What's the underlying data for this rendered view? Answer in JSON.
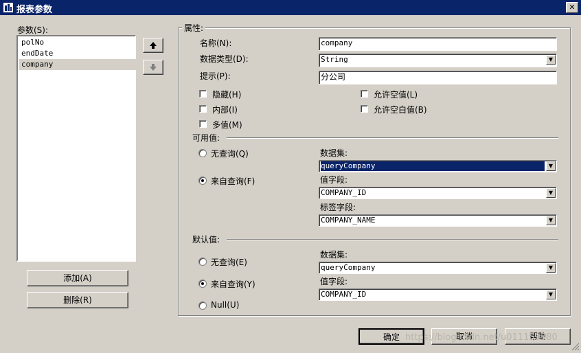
{
  "window": {
    "title": "报表参数",
    "close_glyph": "✕"
  },
  "params": {
    "label": "参数(S):",
    "items": [
      "polNo",
      "endDate",
      "company"
    ],
    "selected_index": 2,
    "add_label": "添加(A)",
    "delete_label": "删除(R)",
    "up_glyph": "🡅",
    "down_glyph": "🡇"
  },
  "properties": {
    "group_label": "属性:",
    "name_label": "名称(N):",
    "name_value": "company",
    "type_label": "数据类型(D):",
    "type_value": "String",
    "prompt_label": "提示(P):",
    "prompt_value": "分公司",
    "hidden_label": "隐藏(H)",
    "internal_label": "内部(I)",
    "multi_label": "多值(M)",
    "allow_null_label": "允许空值(L)",
    "allow_blank_label": "允许空白值(B)"
  },
  "available": {
    "group_label": "可用值:",
    "no_query_label": "无查询(Q)",
    "from_query_label": "来自查询(F)",
    "dataset_label": "数据集:",
    "dataset_value": "queryCompany",
    "value_field_label": "值字段:",
    "value_field_value": "COMPANY_ID",
    "label_field_label": "标签字段:",
    "label_field_value": "COMPANY_NAME"
  },
  "default": {
    "group_label": "默认值:",
    "no_query_label": "无查询(E)",
    "from_query_label": "来自查询(Y)",
    "null_label": "Null(U)",
    "dataset_label": "数据集:",
    "dataset_value": "queryCompany",
    "value_field_label": "值字段:",
    "value_field_value": "COMPANY_ID"
  },
  "buttons": {
    "ok": "确定",
    "cancel": "取消",
    "help": "帮助"
  },
  "watermark": "https://blog.csdn.net/u011159380",
  "colors": {
    "titlebar": "#0a246a",
    "face": "#d4d0c8",
    "selection": "#0a246a"
  }
}
